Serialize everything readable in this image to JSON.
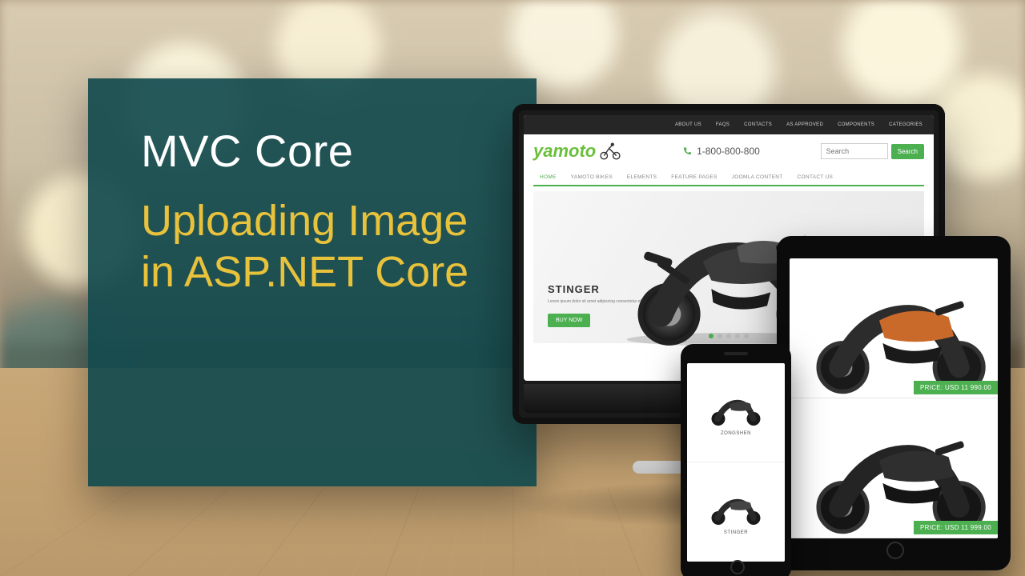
{
  "card": {
    "title": "MVC Core",
    "subtitle": "Uploading Image in ASP.NET Core"
  },
  "monitor": {
    "topnav": [
      "ABOUT US",
      "FAQS",
      "CONTACTS",
      "AS APPROVED",
      "COMPONENTS",
      "CATEGORIES"
    ],
    "logo": "yamoto",
    "phone": "1-800-800-800",
    "search_placeholder": "Search",
    "search_button": "Search",
    "mainnav": [
      "HOME",
      "YAMOTO BIKES",
      "ELEMENTS",
      "FEATURE PAGES",
      "JOOMLA CONTENT",
      "CONTACT US"
    ],
    "hero_title": "STINGER",
    "hero_sub": "Lorem ipsum dolor sit amet adipiscing consectetur elit sed diam.",
    "hero_cta": "BUY NOW"
  },
  "tablet": {
    "price1": "PRICE: USD 11 990.00",
    "price2": "PRICE: USD 11 999.00"
  },
  "phone": {
    "item1": "ZONGSHEN",
    "item2": "STINGER"
  },
  "colors": {
    "teal": "#124a4e",
    "accent": "#e9c23c",
    "green": "#4caf50"
  }
}
